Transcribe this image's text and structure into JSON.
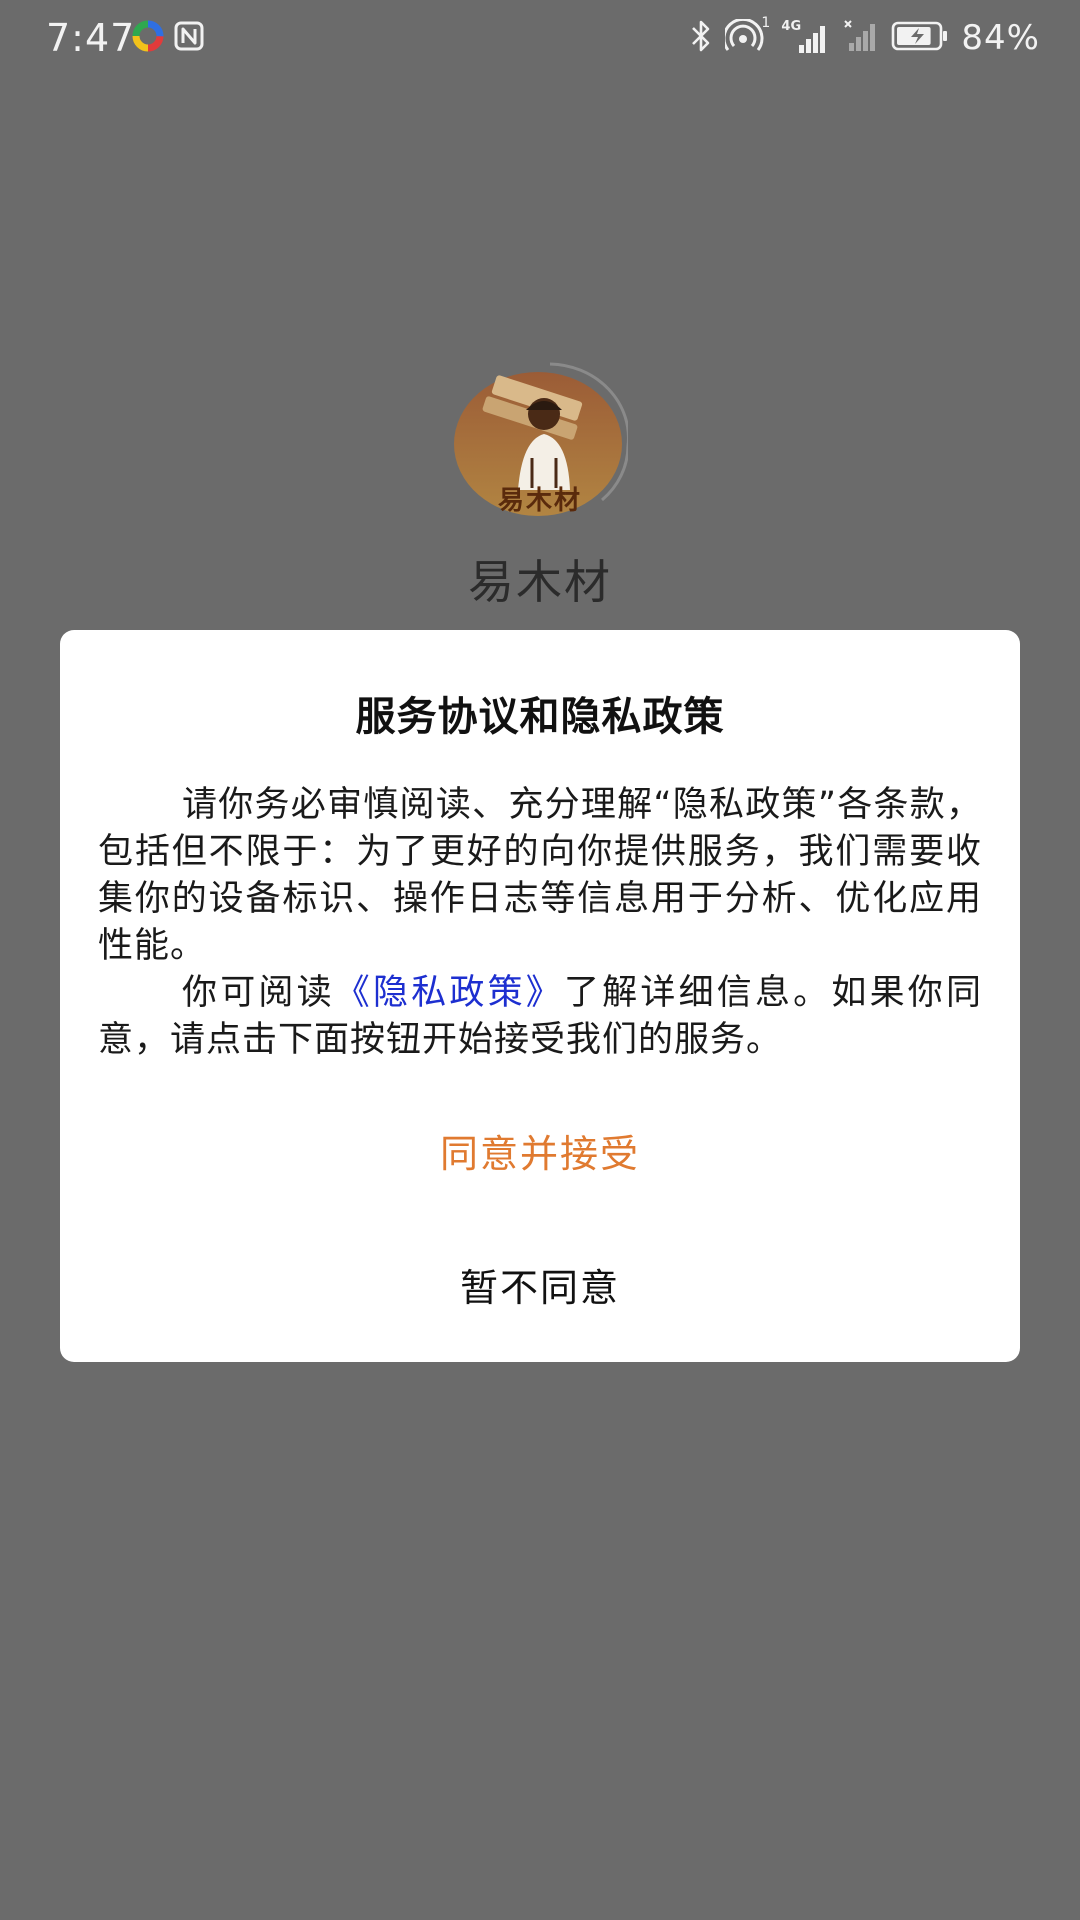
{
  "status_bar": {
    "time": "7:47",
    "battery_percent_label": "84%",
    "battery_level": 0.84,
    "left_icons": [
      "multicolor-app-icon",
      "nfc-icon"
    ],
    "right_icons": [
      "bluetooth-icon",
      "hotspot-icon",
      "signal-4g-icon",
      "signal-no-service-icon",
      "battery-charging-icon"
    ],
    "signal_labels": {
      "hotspot_badge": "1",
      "network_type": "4G"
    }
  },
  "splash": {
    "logo_text": "易木材",
    "app_name": "易木材"
  },
  "dialog": {
    "title": "服务协议和隐私政策",
    "paragraph1": "请你务必审慎阅读、充分理解“隐私政策”各条款，包括但不限于：为了更好的向你提供服务，我们需要收集你的设备标识、操作日志等信息用于分析、优化应用性能。",
    "paragraph2_prefix": "你可阅读",
    "privacy_link": "《隐私政策》",
    "paragraph2_suffix": "了解详细信息。如果你同意，请点击下面按钮开始接受我们的服务。",
    "agree_label": "同意并接受",
    "disagree_label": "暂不同意"
  },
  "colors": {
    "overlay_background": "#6b6b6b",
    "link": "#1d2fd0",
    "agree": "#e07a30",
    "logo_gradient_top": "#b5541a",
    "logo_gradient_bottom": "#d8932c"
  }
}
